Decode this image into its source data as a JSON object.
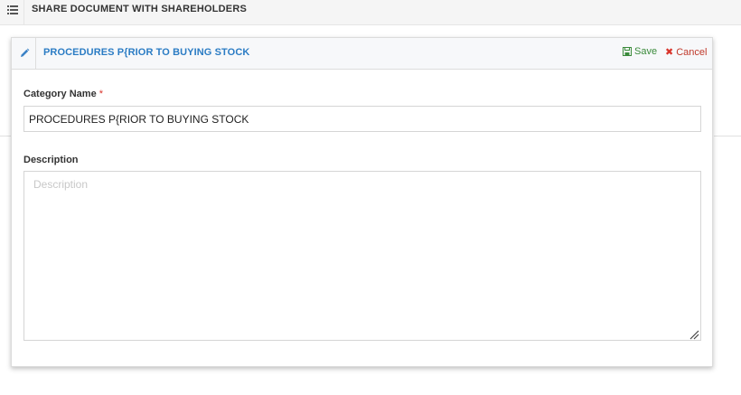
{
  "topbar": {
    "title": "SHARE DOCUMENT WITH SHAREHOLDERS",
    "icon": "list-icon"
  },
  "card": {
    "title": "PROCEDURES P{RIOR TO BUYING STOCK",
    "icon": "pencil-icon",
    "actions": {
      "save_label": "Save",
      "cancel_label": "Cancel",
      "save_color": "#3a8a3a",
      "cancel_color": "#c0392b"
    },
    "colors": {
      "title": "#2b7cc4",
      "required_marker": "#d9342b"
    }
  },
  "form": {
    "category_name": {
      "label": "Category Name",
      "required_marker": "*",
      "value": "PROCEDURES P{RIOR TO BUYING STOCK"
    },
    "description": {
      "label": "Description",
      "placeholder": "Description",
      "value": ""
    }
  }
}
